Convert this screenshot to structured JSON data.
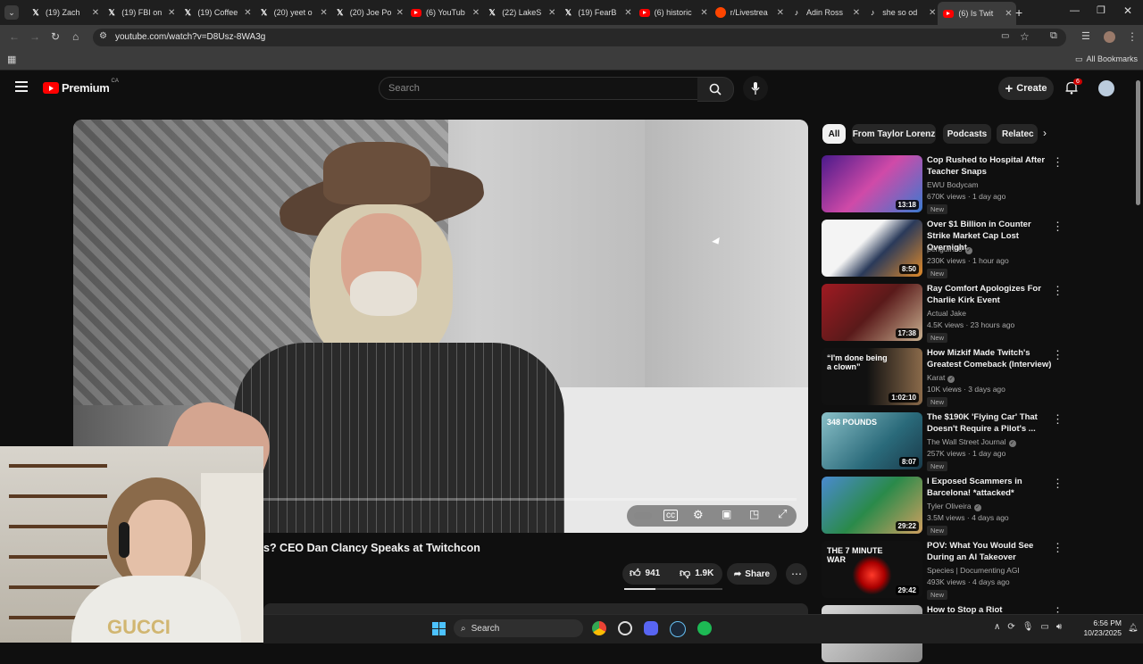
{
  "browser": {
    "tabs": [
      {
        "title": "(19) Zach",
        "fav": "X",
        "color": "#ffffff"
      },
      {
        "title": "(19) FBI on",
        "fav": "X",
        "color": "#ffffff"
      },
      {
        "title": "(19) Coffee",
        "fav": "X",
        "color": "#ffffff"
      },
      {
        "title": "(20) yeet o",
        "fav": "X",
        "color": "#ffffff"
      },
      {
        "title": "(20) Joe Po",
        "fav": "X",
        "color": "#ffffff"
      },
      {
        "title": "(6) YouTub",
        "fav": "yt",
        "color": "#ff0000"
      },
      {
        "title": "(22) LakeS",
        "fav": "X",
        "color": "#ffffff"
      },
      {
        "title": "(19) FearB",
        "fav": "X",
        "color": "#ffffff"
      },
      {
        "title": "(6) historic",
        "fav": "yt",
        "color": "#ff0000"
      },
      {
        "title": "r/Livestrea",
        "fav": "reddit",
        "color": "#ff4500"
      },
      {
        "title": "Adin Ross",
        "fav": "tiktok",
        "color": "#ffffff"
      },
      {
        "title": "she so od",
        "fav": "tiktok",
        "color": "#ffffff"
      },
      {
        "title": "(6) Is Twit",
        "fav": "yt",
        "color": "#ff0000",
        "active": true
      }
    ],
    "url": "youtube.com/watch?v=D8Usz-8WA3g",
    "all_bookmarks": "All Bookmarks"
  },
  "youtube": {
    "logo_text": "Premium",
    "region": "CA",
    "search_placeholder": "Search",
    "create_label": "Create",
    "notif_count": "6"
  },
  "video": {
    "title_partial": "s? CEO Dan Clancy Speaks at Twitchcon",
    "likes": "941",
    "dislikes": "1.9K",
    "share_label": "Share"
  },
  "chips": [
    "All",
    "From Taylor Lorenz",
    "Podcasts",
    "Relatec"
  ],
  "recommendations": [
    {
      "title": "Cop Rushed to Hospital After Teacher Snaps",
      "channel": "EWU Bodycam",
      "verified": false,
      "meta": "670K views · 1 day ago",
      "badge": "New",
      "duration": "13:18",
      "thumb": "linear-gradient(135deg,#4a1a8a,#d04aa8 50%,#3a7ad0)"
    },
    {
      "title": "Over $1 Billion in Counter Strike Market Cap Lost Overnight",
      "channel": "penguin20",
      "verified": true,
      "meta": "230K views · 1 hour ago",
      "badge": "New",
      "duration": "8:50",
      "thumb": "linear-gradient(135deg,#f4f4f4 40%,#2a3a5a 60%,#e08a2a)"
    },
    {
      "title": "Ray Comfort Apologizes For Charlie Kirk Event",
      "channel": "Actual Jake",
      "verified": false,
      "meta": "4.5K views · 23 hours ago",
      "badge": "New",
      "duration": "17:38",
      "thumb": "linear-gradient(135deg,#a01a22,#5a1a1a 50%,#c8b090)"
    },
    {
      "title": "How Mizkif Made Twitch's Greatest Comeback (Interview)",
      "channel": "Karat",
      "verified": true,
      "meta": "10K views · 3 days ago",
      "badge": "New",
      "duration": "1:02:10",
      "thumb": "linear-gradient(90deg,#111 45%,#8a6a4a)",
      "thumb_text": "“I'm done being a clown”"
    },
    {
      "title": "The $190K 'Flying Car' That Doesn't Require a Pilot's ...",
      "channel": "The Wall Street Journal",
      "verified": true,
      "meta": "257K views · 1 day ago",
      "badge": "New",
      "duration": "8:07",
      "thumb": "linear-gradient(135deg,#8ac0c8,#2a6a7a 60%,#1a3a4a)",
      "thumb_text": "348 POUNDS"
    },
    {
      "title": "I Exposed Scammers in Barcelona! *attacked*",
      "channel": "Tyler Oliveira",
      "verified": true,
      "meta": "3.5M views · 4 days ago",
      "badge": "New",
      "duration": "29:22",
      "thumb": "linear-gradient(135deg,#4a8ad0,#2a8a4a 50%,#d0a060)"
    },
    {
      "title": "POV: What You Would See During an AI Takeover",
      "channel": "Species | Documenting AGI",
      "verified": false,
      "meta": "493K views · 4 days ago",
      "badge": "New",
      "duration": "29:42",
      "thumb": "radial-gradient(circle at 50% 60%,#ff3a2a 0,#a00 14px,#111 22px)",
      "thumb_text": "THE 7 MINUTE WAR"
    },
    {
      "title": "How to Stop a Riot",
      "channel": "",
      "verified": false,
      "meta": "",
      "badge": "",
      "duration": "",
      "thumb": "linear-gradient(135deg,#d8d8d8,#8a8a8a)"
    }
  ],
  "taskbar": {
    "search_label": "Search",
    "time": "6:56 PM",
    "date": "10/23/2025"
  },
  "colors": {
    "yt_red": "#ff0000",
    "bg": "#0f0f0f",
    "accent": "#3ea6ff"
  }
}
